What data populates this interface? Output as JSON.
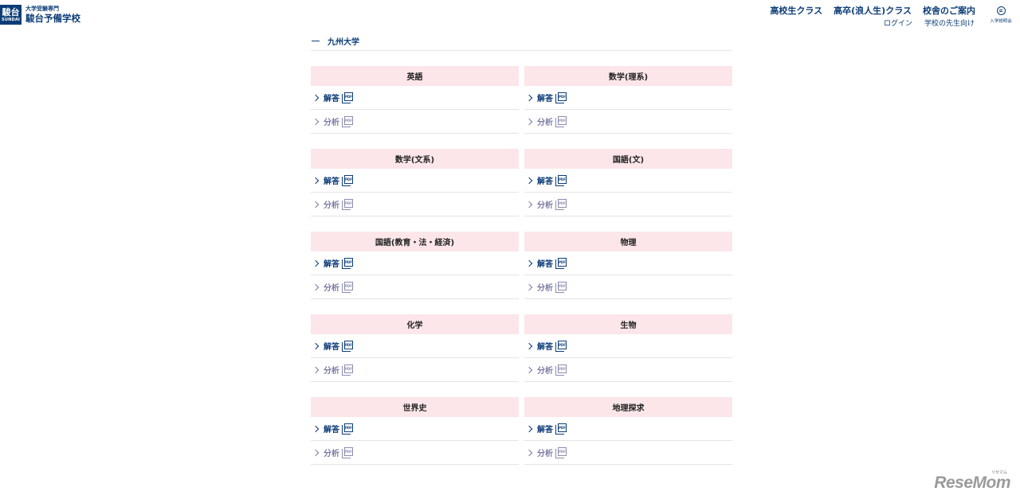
{
  "header": {
    "logo_kanji": "駿台",
    "logo_roman": "SUNDAI",
    "logo_sub": "大学受験専門",
    "logo_main": "駿台予備学校",
    "nav_main": [
      "高校生クラス",
      "高卒(浪人生)クラス",
      "校舎のご案内"
    ],
    "nav_sub": [
      "ログイン",
      "学校の先生向け"
    ],
    "briefing_label": "入学説明会"
  },
  "breadcrumb": "九州大学",
  "answer_label": "解答",
  "analysis_label": "分析",
  "pdf_badge": "PDF",
  "subjects": [
    {
      "name": "英語"
    },
    {
      "name": "数学(理系)"
    },
    {
      "name": "数学(文系)"
    },
    {
      "name": "国語(文)"
    },
    {
      "name": "国語(教育・法・経済)"
    },
    {
      "name": "物理"
    },
    {
      "name": "化学"
    },
    {
      "name": "生物"
    },
    {
      "name": "世界史"
    },
    {
      "name": "地理探求"
    }
  ],
  "watermark": "ReseMom",
  "watermark_ruby": "リセマム"
}
